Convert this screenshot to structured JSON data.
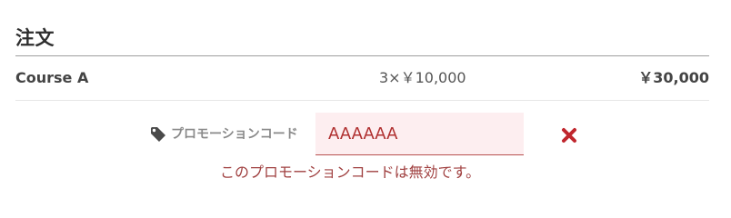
{
  "order": {
    "title": "注文",
    "line_item": {
      "name": "Course A",
      "calc": "3×￥10,000",
      "total": "￥30,000"
    },
    "promo": {
      "icon": "tag-icon",
      "label": "プロモーションコード",
      "value": "AAAAAA",
      "clear_icon": "close-icon",
      "error": "このプロモーションコードは無効です。"
    }
  },
  "colors": {
    "error_text": "#a04040",
    "input_background": "#fdeef0",
    "clear_icon": "#c0262d"
  }
}
